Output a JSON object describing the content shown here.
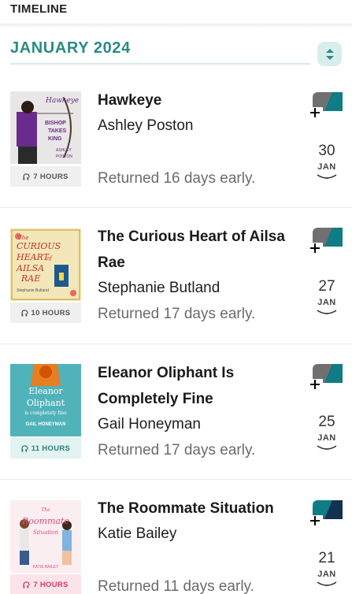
{
  "header": {
    "title": "TIMELINE"
  },
  "month": {
    "label": "JANUARY 2024"
  },
  "colors": {
    "accent": "#2b8a86",
    "teal": "#0f7c86",
    "grey_tag": "#f0f0f0",
    "teal_tag": "#e2f3f1",
    "pink_tag": "#fde4ea"
  },
  "books": [
    {
      "title": "Hawkeye",
      "author": "Ashley Poston",
      "status": "Returned 16 days early.",
      "duration": "7 HOURS",
      "day": "30",
      "month": "JAN"
    },
    {
      "title": "The Curious Heart of Ailsa Rae",
      "author": "Stephanie Butland",
      "status": "Returned 17 days early.",
      "duration": "10 HOURS",
      "day": "27",
      "month": "JAN"
    },
    {
      "title": "Eleanor Oliphant Is Completely Fine",
      "author": "Gail Honeyman",
      "status": "Returned 17 days early.",
      "duration": "11 HOURS",
      "day": "25",
      "month": "JAN"
    },
    {
      "title": "The Roommate Situation",
      "author": "Katie Bailey",
      "status": "Returned 11 days early.",
      "duration": "7 HOURS",
      "day": "21",
      "month": "JAN"
    }
  ],
  "covers": {
    "hawkeye": {
      "lines": [
        "Hawkeye",
        "BISHOP",
        "TAKES",
        "KING",
        "ASHLEY",
        "POSTON"
      ]
    },
    "curious": {
      "lines": [
        "The",
        "CURIOUS",
        "HEART",
        "of",
        "AILSA",
        "RAE",
        "Stephanie Butland"
      ]
    },
    "eleanor": {
      "lines": [
        "Eleanor",
        "Oliphant",
        "is completely fine",
        "GAIL HONEYMAN"
      ]
    },
    "roommate": {
      "lines": [
        "The",
        "Roommate",
        "Situation",
        "KATIE BAILEY"
      ]
    }
  }
}
